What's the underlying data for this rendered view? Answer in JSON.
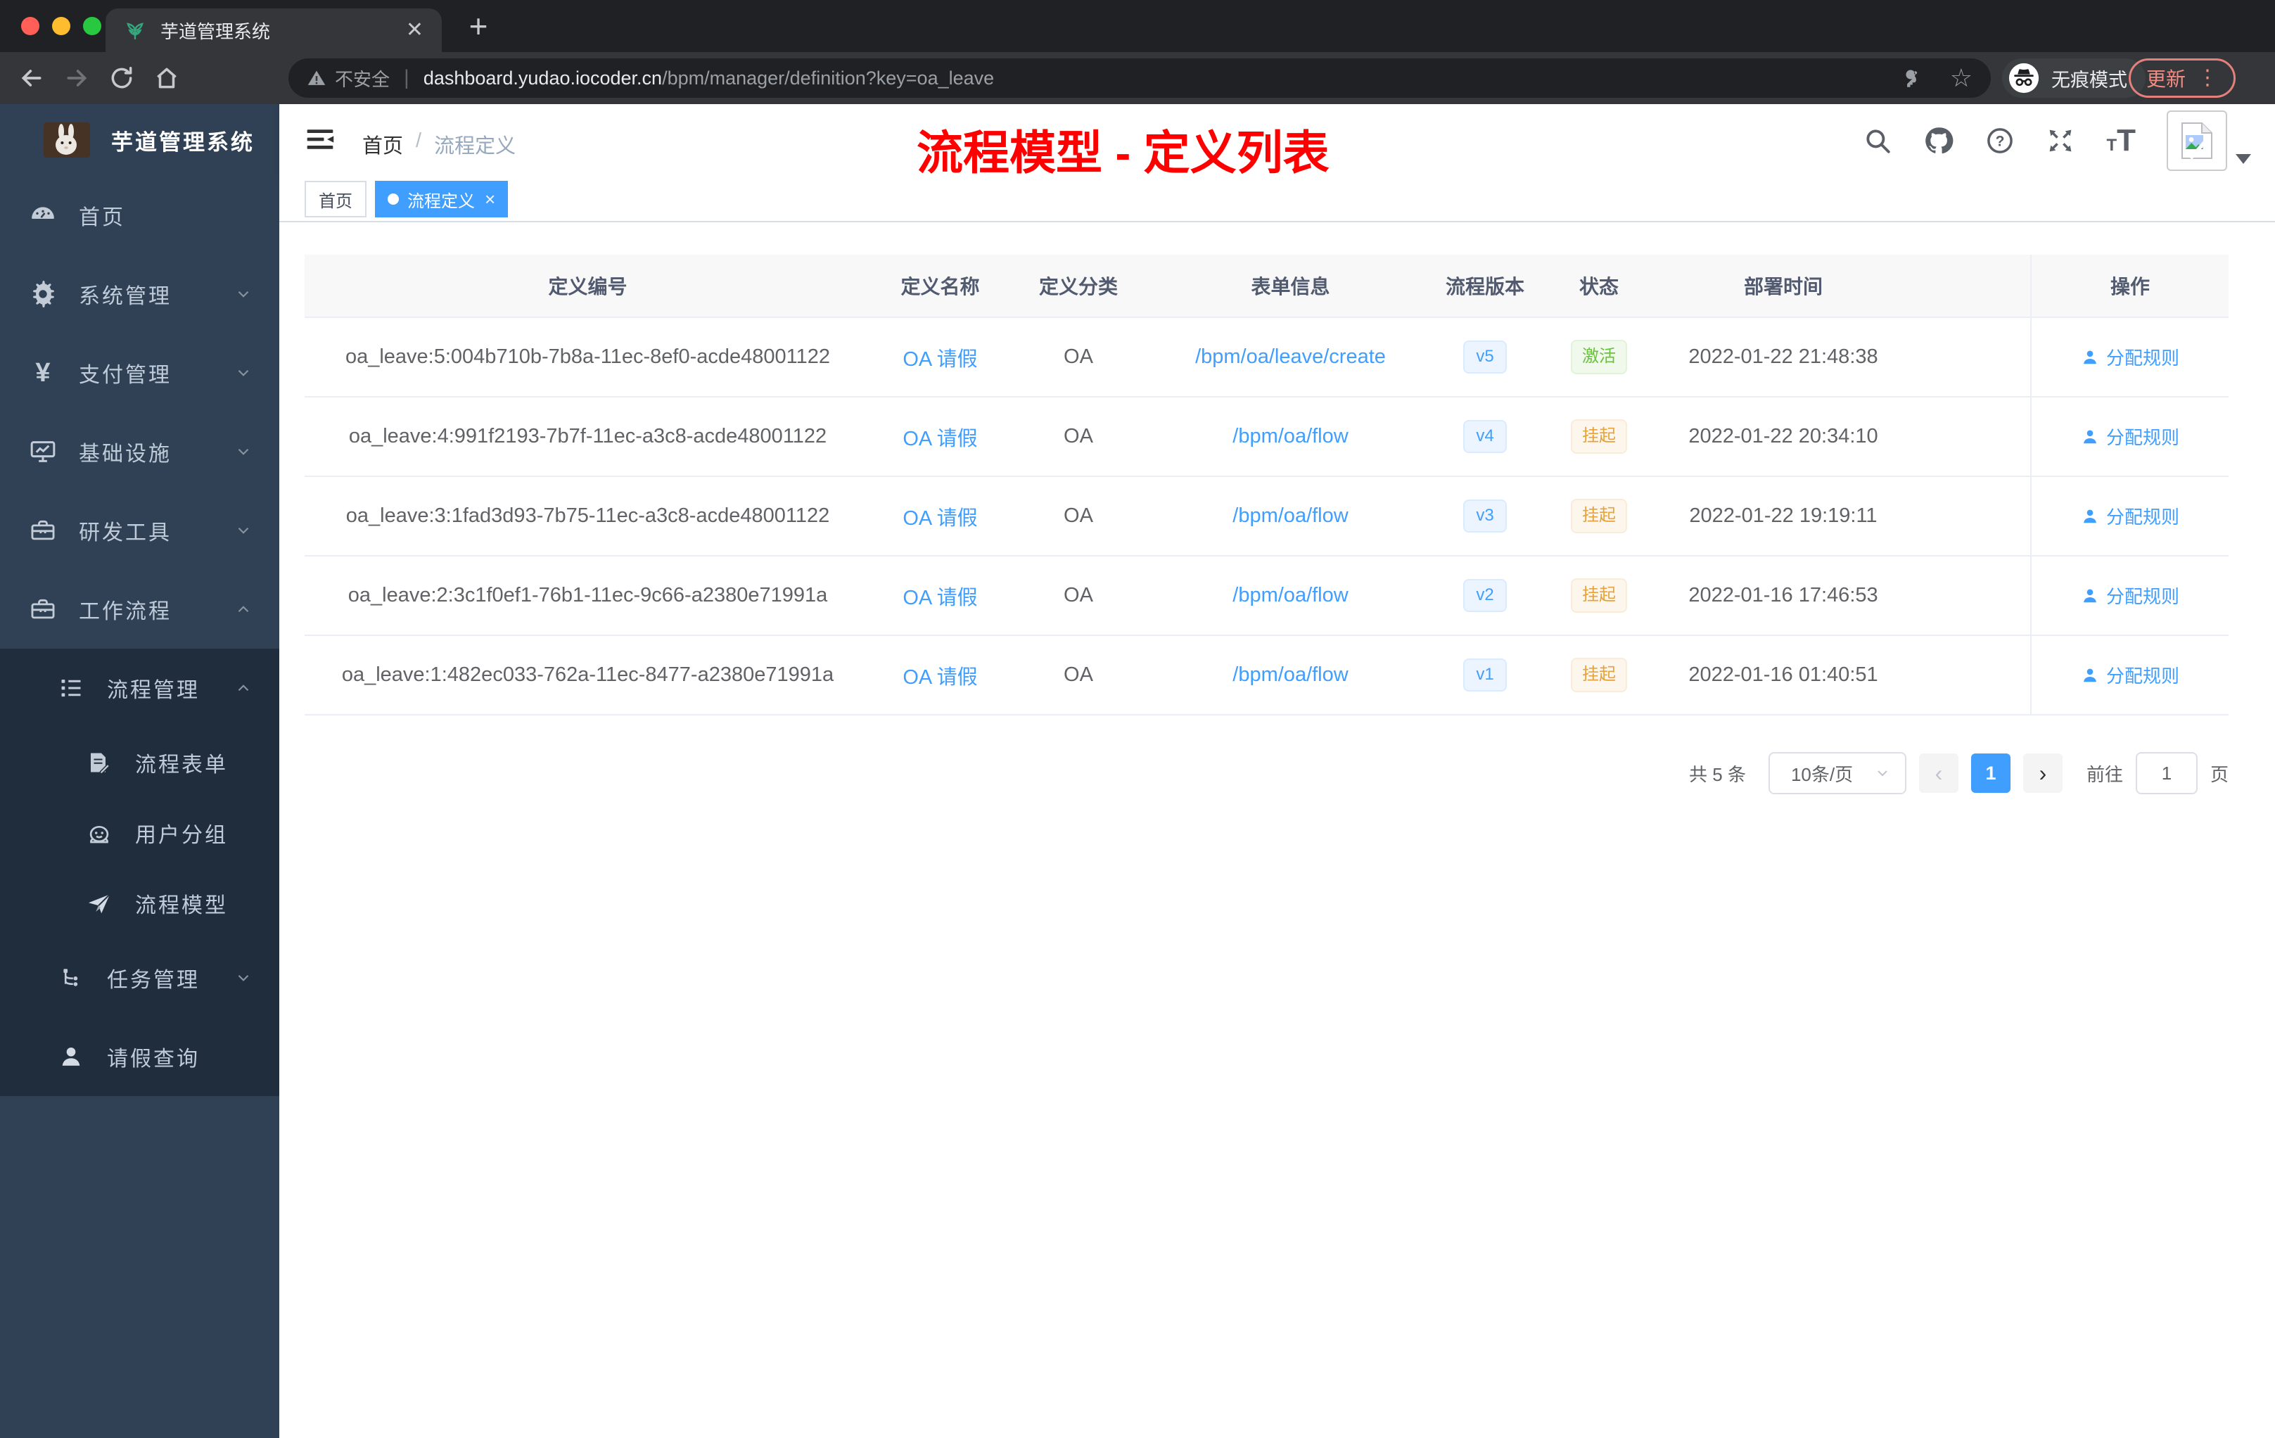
{
  "colors": {
    "accent": "#409eff",
    "success": "#67c23a",
    "warning": "#e6a23c",
    "sidebar_bg": "#304156",
    "submenu_bg": "#1f2d3d",
    "annotation_red": "#fe0000",
    "chrome_dark": "#202124",
    "chrome_toolbar": "#35363a"
  },
  "browser": {
    "tab_title": "芋道管理系统",
    "tab_favicon": "plant-icon",
    "new_tab_label": "+",
    "security_label": "不安全",
    "url_host": "dashboard.yudao.iocoder.cn",
    "url_path": "/bpm/manager/definition?key=oa_leave",
    "incognito_label": "无痕模式",
    "update_label": "更新"
  },
  "sidebar": {
    "app_title": "芋道管理系统",
    "items": [
      {
        "icon": "dashboard-icon",
        "label": "首页"
      },
      {
        "icon": "gear-icon",
        "label": "系统管理",
        "chevron": "down"
      },
      {
        "icon": "yen-icon",
        "label": "支付管理",
        "chevron": "down"
      },
      {
        "icon": "monitor-icon",
        "label": "基础设施",
        "chevron": "down"
      },
      {
        "icon": "toolbox-icon",
        "label": "研发工具",
        "chevron": "down"
      },
      {
        "icon": "briefcase-icon",
        "label": "工作流程",
        "chevron": "up"
      },
      {
        "icon": "list-icon",
        "label": "流程管理",
        "chevron": "up",
        "level": 2
      },
      {
        "icon": "form-icon",
        "label": "流程表单",
        "level": 3
      },
      {
        "icon": "robot-icon",
        "label": "用户分组",
        "level": 3
      },
      {
        "icon": "paper-plane-icon",
        "label": "流程模型",
        "level": 3
      },
      {
        "icon": "tree-icon",
        "label": "任务管理",
        "chevron": "down",
        "level": 2
      },
      {
        "icon": "user-icon",
        "label": "请假查询",
        "level": 2
      }
    ]
  },
  "navbar": {
    "breadcrumb": {
      "home": "首页",
      "separator": "/",
      "current": "流程定义"
    },
    "annotation": "流程模型 - 定义列表",
    "icons": [
      "search-icon",
      "github-icon",
      "help-icon",
      "fullscreen-icon",
      "font-size-icon",
      "avatar-broken-image"
    ]
  },
  "tags": {
    "items": [
      {
        "label": "首页",
        "active": false
      },
      {
        "label": "流程定义",
        "active": true,
        "closable": true
      }
    ]
  },
  "table": {
    "columns": {
      "id": "定义编号",
      "name": "定义名称",
      "category": "定义分类",
      "form": "表单信息",
      "version": "流程版本",
      "status": "状态",
      "deploy_time": "部署时间",
      "action": "操作"
    },
    "rows": [
      {
        "id": "oa_leave:5:004b710b-7b8a-11ec-8ef0-acde48001122",
        "name": "OA 请假",
        "category": "OA",
        "form": "/bpm/oa/leave/create",
        "version": "v5",
        "status": "激活",
        "status_type": "success",
        "deploy_time": "2022-01-22 21:48:38",
        "action": "分配规则"
      },
      {
        "id": "oa_leave:4:991f2193-7b7f-11ec-a3c8-acde48001122",
        "name": "OA 请假",
        "category": "OA",
        "form": "/bpm/oa/flow",
        "version": "v4",
        "status": "挂起",
        "status_type": "warning",
        "deploy_time": "2022-01-22 20:34:10",
        "action": "分配规则"
      },
      {
        "id": "oa_leave:3:1fad3d93-7b75-11ec-a3c8-acde48001122",
        "name": "OA 请假",
        "category": "OA",
        "form": "/bpm/oa/flow",
        "version": "v3",
        "status": "挂起",
        "status_type": "warning",
        "deploy_time": "2022-01-22 19:19:11",
        "action": "分配规则"
      },
      {
        "id": "oa_leave:2:3c1f0ef1-76b1-11ec-9c66-a2380e71991a",
        "name": "OA 请假",
        "category": "OA",
        "form": "/bpm/oa/flow",
        "version": "v2",
        "status": "挂起",
        "status_type": "warning",
        "deploy_time": "2022-01-16 17:46:53",
        "action": "分配规则"
      },
      {
        "id": "oa_leave:1:482ec033-762a-11ec-8477-a2380e71991a",
        "name": "OA 请假",
        "category": "OA",
        "form": "/bpm/oa/flow",
        "version": "v1",
        "status": "挂起",
        "status_type": "warning",
        "deploy_time": "2022-01-16 01:40:51",
        "action": "分配规则"
      }
    ]
  },
  "pagination": {
    "total_label": "共 5 条",
    "page_size_label": "10条/页",
    "prev_label": "‹",
    "current_page": "1",
    "next_label": "›",
    "goto_label": "前往",
    "goto_value": "1",
    "page_unit": "页"
  }
}
